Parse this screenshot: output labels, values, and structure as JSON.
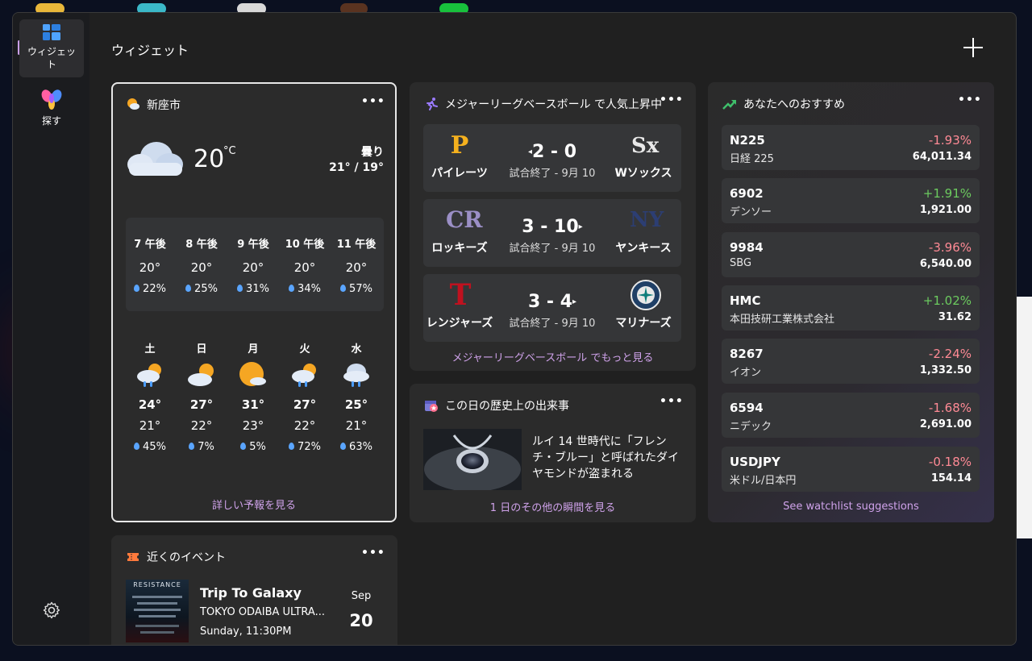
{
  "rail": {
    "widgets_label": "ウィジェット",
    "discover_label": "探す"
  },
  "main": {
    "title": "ウィジェット"
  },
  "weather": {
    "city": "新座市",
    "temp": "20",
    "unit": "°C",
    "condition": "曇り",
    "hi_lo": "21° / 19°",
    "hourly": [
      {
        "time": "7 午後",
        "temp": "20°",
        "precip": "22%"
      },
      {
        "time": "8 午後",
        "temp": "20°",
        "precip": "25%"
      },
      {
        "time": "9 午後",
        "temp": "20°",
        "precip": "31%"
      },
      {
        "time": "10 午後",
        "temp": "20°",
        "precip": "34%"
      },
      {
        "time": "11 午後",
        "temp": "20°",
        "precip": "57%"
      }
    ],
    "daily": [
      {
        "day": "土",
        "high": "24°",
        "low": "21°",
        "precip": "45%",
        "icon": "rain-sun-icon"
      },
      {
        "day": "日",
        "high": "27°",
        "low": "22°",
        "precip": "7%",
        "icon": "partly-cloudy-icon"
      },
      {
        "day": "月",
        "high": "31°",
        "low": "23°",
        "precip": "5%",
        "icon": "sunny-cloud-icon"
      },
      {
        "day": "火",
        "high": "27°",
        "low": "22°",
        "precip": "72%",
        "icon": "rain-sun-icon"
      },
      {
        "day": "水",
        "high": "25°",
        "low": "21°",
        "precip": "63%",
        "icon": "rain-cloud-icon"
      }
    ],
    "link": "詳しい予報を見る"
  },
  "baseball": {
    "title": "メジャーリーグベースボール で人気上昇中",
    "games": [
      {
        "home": "パイレーツ",
        "away": "Wソックス",
        "score": "2 - 0",
        "status": "試合終了 - 9月 10",
        "arrow": "left",
        "home_color": "#f5b11e",
        "away_color": "#e8e8e8"
      },
      {
        "home": "ロッキーズ",
        "away": "ヤンキース",
        "score": "3 - 10",
        "status": "試合終了 - 9月 10",
        "arrow": "right",
        "home_color": "#9b8fc6",
        "away_color": "#1c2e5a"
      },
      {
        "home": "レンジャーズ",
        "away": "マリナーズ",
        "score": "3 - 4",
        "status": "試合終了 - 9月 10",
        "arrow": "right",
        "home_color": "#c0111f",
        "away_color": "#1f3f66"
      }
    ],
    "link": "メジャーリーグベースボール でもっと見る"
  },
  "history": {
    "title": "この日の歴史上の出来事",
    "text": "ルイ 14 世時代に「フレンチ・ブルー」と呼ばれたダイヤモンドが盗まれる",
    "link": "1 日のその他の瞬間を見る"
  },
  "stocks": {
    "title": "あなたへのおすすめ",
    "items": [
      {
        "symbol": "N225",
        "name": "日経 225",
        "change": "-1.93%",
        "price": "64,011.34",
        "dir": "neg"
      },
      {
        "symbol": "6902",
        "name": "デンソー",
        "change": "+1.91%",
        "price": "1,921.00",
        "dir": "pos"
      },
      {
        "symbol": "9984",
        "name": "SBG",
        "change": "-3.96%",
        "price": "6,540.00",
        "dir": "neg"
      },
      {
        "symbol": "HMC",
        "name": "本田技研工業株式会社",
        "change": "+1.02%",
        "price": "31.62",
        "dir": "pos"
      },
      {
        "symbol": "8267",
        "name": "イオン",
        "change": "-2.24%",
        "price": "1,332.50",
        "dir": "neg"
      },
      {
        "symbol": "6594",
        "name": "ニデック",
        "change": "-1.68%",
        "price": "2,691.00",
        "dir": "neg"
      },
      {
        "symbol": "USDJPY",
        "name": "米ドル/日本円",
        "change": "-0.18%",
        "price": "154.14",
        "dir": "neg"
      }
    ],
    "link": "See watchlist suggestions"
  },
  "events": {
    "title": "近くのイベント",
    "event_name": "Trip To Galaxy",
    "venue": "TOKYO ODAIBA ULTRA...",
    "time": "Sunday, 11:30PM",
    "month": "Sep",
    "day": "20",
    "poster_title": "RESISTANCE"
  },
  "colors": {
    "accent": "#cfa2ea",
    "negative": "#ff8a95",
    "positive": "#6ccb5f",
    "window": "#202020",
    "card": "#2b2b2b"
  }
}
